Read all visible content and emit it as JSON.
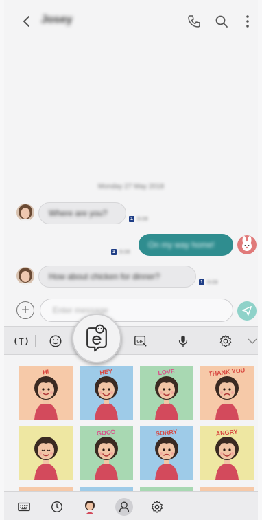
{
  "header": {
    "contact_name": "Josey",
    "icons": [
      "back-icon",
      "phone-icon",
      "search-icon",
      "more-icon"
    ]
  },
  "conversation": {
    "date": "Monday 27 May 2018",
    "messages": [
      {
        "direction": "incoming",
        "text": "Where are you?",
        "unread": "1",
        "time": "9:08"
      },
      {
        "direction": "outgoing",
        "text": "On my way home!",
        "unread": "1",
        "time": "9:08"
      },
      {
        "direction": "incoming",
        "text": "How about chicken for dinner?",
        "unread": "1",
        "time": "9:09"
      }
    ]
  },
  "compose": {
    "placeholder": "Enter message",
    "icons": [
      "add-icon",
      "send-icon"
    ]
  },
  "keyboard_toolbar": {
    "icons": [
      "text-mode-icon",
      "emoji-icon",
      "ar-emoji-icon",
      "gif-icon",
      "microphone-icon",
      "settings-icon",
      "chevron-down-icon"
    ],
    "gif_label": "GIF"
  },
  "stickers": {
    "captions": [
      "HI",
      "HEY",
      "LOVE",
      "THANK YOU",
      "",
      "GOOD",
      "SORRY",
      "ANGRY"
    ],
    "background_colors": [
      "#f6c9a8",
      "#9ecbe8",
      "#a8d8b2",
      "#f6c9a8",
      "#eee7a2",
      "#a8d8b2",
      "#9ecbe8",
      "#eee7a2"
    ]
  },
  "bottom_bar": {
    "icons": [
      "keyboard-icon",
      "recent-icon",
      "ar-emoji-avatar-icon",
      "emoji-sticker-icon",
      "settings-icon"
    ]
  },
  "colors": {
    "accent": "#2f8d8f",
    "send": "#8fd2c9",
    "unread_badge": "#1f3e86"
  }
}
